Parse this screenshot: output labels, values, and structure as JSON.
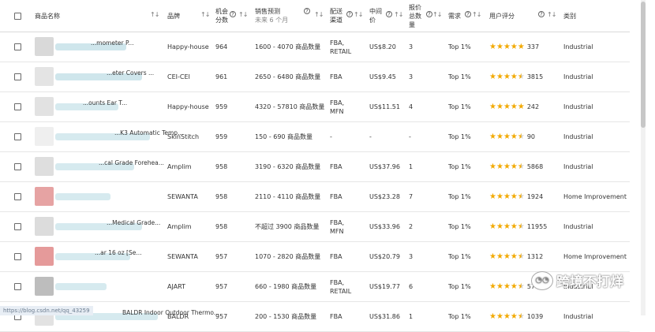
{
  "header": {
    "name": "商品名称",
    "brand": "品牌",
    "opportunity": "机会分数",
    "forecast": "销售预测",
    "forecast_sub": "未来 6 个月",
    "fulfillment": "配送渠道",
    "price": "中间价",
    "offers": "报价总数量",
    "demand": "需求",
    "rating": "用户评分",
    "category": "类别"
  },
  "rows": [
    {
      "name": "...mometer P...",
      "brand": "Happy-house",
      "score": "964",
      "forecast": "1600 - 4070 商品数量",
      "ful": "FBA, RETAIL",
      "price": "US$8.20",
      "offers": "3",
      "demand": "Top 1%",
      "stars": [
        1,
        1,
        1,
        1,
        1
      ],
      "reviews": "337",
      "category": "Industrial",
      "thumb": "#d9d9d9",
      "blur": "#cfe6ec"
    },
    {
      "name": "...eter Covers ...",
      "brand": "CEI-CEI",
      "score": "961",
      "forecast": "2650 - 6480 商品数量",
      "ful": "FBA",
      "price": "US$9.45",
      "offers": "3",
      "demand": "Top 1%",
      "stars": [
        1,
        1,
        1,
        1,
        0.5
      ],
      "reviews": "3815",
      "category": "Industrial",
      "thumb": "#e4e4e4",
      "blur": "#cfe6ec"
    },
    {
      "name": "...ounts Ear T...",
      "brand": "Happy-house",
      "score": "959",
      "forecast": "4320 - 57810 商品数量",
      "ful": "FBA, MFN",
      "price": "US$11.51",
      "offers": "4",
      "demand": "Top 1%",
      "stars": [
        1,
        1,
        1,
        1,
        1
      ],
      "reviews": "242",
      "category": "Industrial",
      "thumb": "#e2e2e2",
      "blur": "#d6eaef"
    },
    {
      "name": "...K3 Automatic Temp...",
      "brand": "SkinStitch",
      "score": "959",
      "forecast": "150 - 690 商品数量",
      "ful": "-",
      "price": "-",
      "offers": "-",
      "demand": "Top 1%",
      "stars": [
        1,
        1,
        1,
        1,
        0.5
      ],
      "reviews": "90",
      "category": "Industrial",
      "thumb": "#efefef",
      "blur": "#d6eaef"
    },
    {
      "name": "...cal Grade Forehea...",
      "brand": "Amplim",
      "score": "958",
      "forecast": "3190 - 6320 商品数量",
      "ful": "FBA",
      "price": "US$37.96",
      "offers": "1",
      "demand": "Top 1%",
      "stars": [
        1,
        1,
        1,
        1,
        0.5
      ],
      "reviews": "5868",
      "category": "Industrial",
      "thumb": "#dedede",
      "blur": "#d6eaef"
    },
    {
      "name": "",
      "brand": "SEWANTA",
      "score": "958",
      "forecast": "2110 - 4110 商品数量",
      "ful": "FBA",
      "price": "US$23.28",
      "offers": "7",
      "demand": "Top 1%",
      "stars": [
        1,
        1,
        1,
        1,
        0.5
      ],
      "reviews": "1924",
      "category": "Home Improvement",
      "thumb": "#e6a3a3",
      "blur": "#d6eaef"
    },
    {
      "name": "...Medical Grade...",
      "brand": "Amplim",
      "score": "958",
      "forecast": "不超过 3900 商品数量",
      "ful": "FBA, MFN",
      "price": "US$33.96",
      "offers": "2",
      "demand": "Top 1%",
      "stars": [
        1,
        1,
        1,
        1,
        0.5
      ],
      "reviews": "11955",
      "category": "Industrial",
      "thumb": "#dcdcdc",
      "blur": "#d6eaef"
    },
    {
      "name": "...ar 16 oz [Se...",
      "brand": "SEWANTA",
      "score": "957",
      "forecast": "1070 - 2820 商品数量",
      "ful": "FBA",
      "price": "US$20.79",
      "offers": "3",
      "demand": "Top 1%",
      "stars": [
        1,
        1,
        1,
        1,
        0.5
      ],
      "reviews": "1312",
      "category": "Home Improvement",
      "thumb": "#e59a9a",
      "blur": "#d6eaef"
    },
    {
      "name": "",
      "brand": "AJART",
      "score": "957",
      "forecast": "660 - 1980 商品数量",
      "ful": "FBA, RETAIL",
      "price": "US$19.77",
      "offers": "6",
      "demand": "Top 1%",
      "stars": [
        1,
        1,
        1,
        1,
        0.5
      ],
      "reviews": "574",
      "category": "Industrial",
      "thumb": "#bdbdbd",
      "blur": "#d6eaef"
    },
    {
      "name": "BALDR Indoor Outdoor Thermo...",
      "brand": "BALDR",
      "score": "957",
      "forecast": "200 - 1530 商品数量",
      "ful": "FBA",
      "price": "US$31.86",
      "offers": "1",
      "demand": "Top 1%",
      "stars": [
        1,
        1,
        1,
        1,
        0.5
      ],
      "reviews": "1039",
      "category": "Industrial",
      "thumb": "#e2e2e2",
      "blur": "#d6eaef"
    }
  ],
  "watermark": "跨境不打烊",
  "footer_url": "https://blog.csdn.net/qq_43259"
}
